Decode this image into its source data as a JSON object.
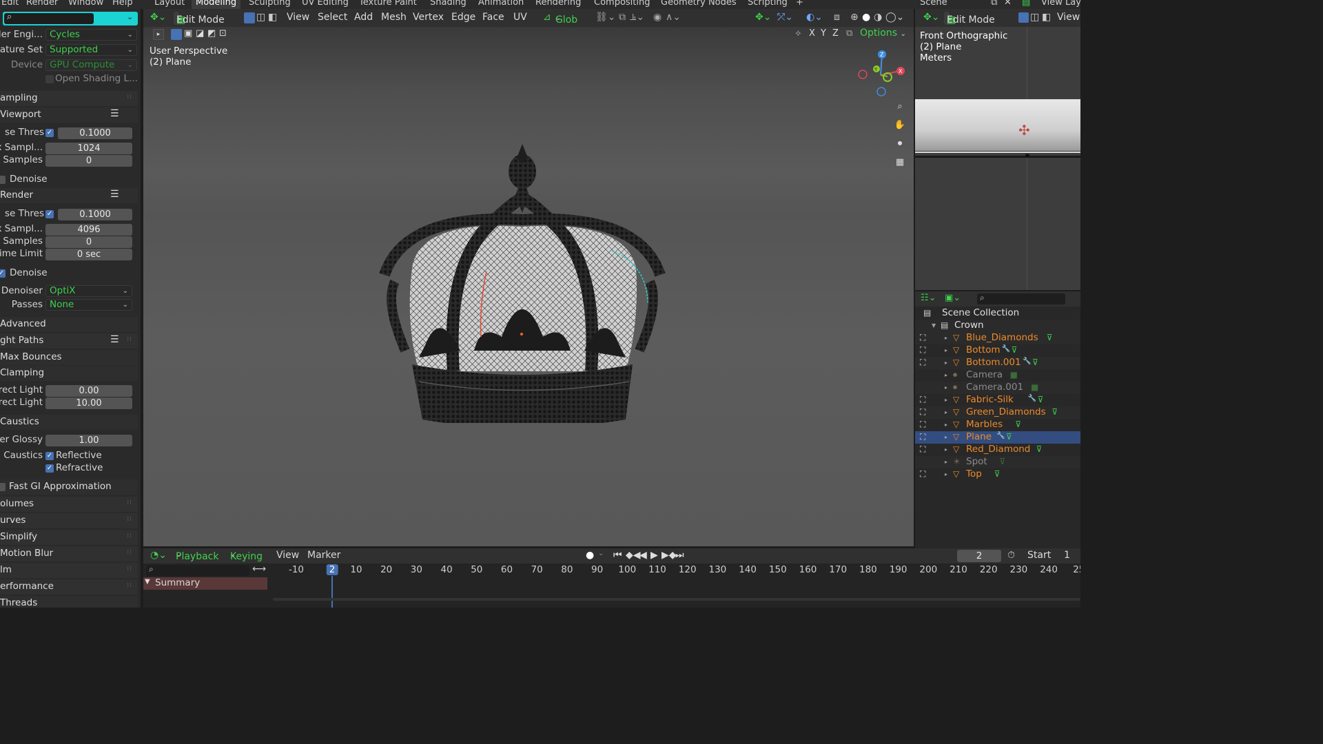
{
  "topbar": {
    "menus": [
      "Edit",
      "Render",
      "Window",
      "Help"
    ],
    "workspaces": [
      "Layout",
      "Modeling",
      "Sculpting",
      "UV Editing",
      "Texture Paint",
      "Shading",
      "Animation",
      "Rendering",
      "Compositing",
      "Geometry Nodes",
      "Scripting"
    ],
    "add_tab": "+",
    "scene_label": "Scene",
    "view_layer_label": "View Lay"
  },
  "viewport_header": {
    "mode": "Edit Mode",
    "menus": [
      "View",
      "Select",
      "Add",
      "Mesh",
      "Vertex",
      "Edge",
      "Face",
      "UV"
    ],
    "transform_orientation": "Glob",
    "options_label": "Options",
    "axes": [
      "X",
      "Y",
      "Z"
    ]
  },
  "viewport": {
    "view_name": "User Perspective",
    "object_name": "(2) Plane"
  },
  "right_viewport": {
    "mode": "Edit Mode",
    "view_menu": "View",
    "view_name": "Front Orthographic",
    "object_name": "(2) Plane",
    "units": "Meters"
  },
  "properties": {
    "render_engine": {
      "label": "der Engi...",
      "value": "Cycles"
    },
    "feature_set": {
      "label": "ature Set",
      "value": "Supported"
    },
    "device": {
      "label": "Device",
      "value": "GPU Compute"
    },
    "open_shading": {
      "label": "Open Shading L..."
    },
    "sampling_header": "ampling",
    "viewport_header": "Viewport",
    "viewport_noise_thresh": {
      "label": "se Thres",
      "value": "0.1000"
    },
    "viewport_max_samples": {
      "label": "x Sampl...",
      "value": "1024"
    },
    "viewport_min_samples": {
      "label": "Samples",
      "value": "0"
    },
    "viewport_denoise": {
      "label": "Denoise"
    },
    "render_header": "Render",
    "render_noise_thresh": {
      "label": "se Thres",
      "value": "0.1000"
    },
    "render_max_samples": {
      "label": "x Sampl...",
      "value": "4096"
    },
    "render_min_samples": {
      "label": "Samples",
      "value": "0"
    },
    "render_time_limit": {
      "label": "ime Limit",
      "value": "0 sec"
    },
    "render_denoise": {
      "label": "Denoise"
    },
    "denoiser": {
      "label": "Denoiser",
      "value": "OptiX"
    },
    "passes": {
      "label": "Passes",
      "value": "None"
    },
    "advanced_header": "Advanced",
    "light_paths_header": "ght Paths",
    "max_bounces_header": "Max Bounces",
    "clamping_header": "Clamping",
    "direct_light": {
      "label": "rect Light",
      "value": "0.00"
    },
    "indirect_light": {
      "label": "rect Light",
      "value": "10.00"
    },
    "caustics_header": "Caustics",
    "filter_glossy": {
      "label": "er Glossy",
      "value": "1.00"
    },
    "caustics": {
      "label": "Caustics",
      "reflective": "Reflective",
      "refractive": "Refractive"
    },
    "fast_gi": "Fast GI Approximation",
    "volumes_header": "olumes",
    "curves_header": "urves",
    "simplify_header": "Simplify",
    "motion_blur_header": "Motion Blur",
    "film_header": "lm",
    "performance_header": "erformance",
    "threads_header": "Threads"
  },
  "outliner": {
    "scene_collection": "Scene Collection",
    "collection": "Crown",
    "items": [
      {
        "name": "Blue_Diamonds",
        "kind": "mesh",
        "modifier": false
      },
      {
        "name": "Bottom",
        "kind": "mesh",
        "modifier": true
      },
      {
        "name": "Bottom.001",
        "kind": "mesh",
        "modifier": true
      },
      {
        "name": "Camera",
        "kind": "camera",
        "modifier": false
      },
      {
        "name": "Camera.001",
        "kind": "camera",
        "modifier": false
      },
      {
        "name": "Fabric-Silk",
        "kind": "mesh",
        "modifier": true
      },
      {
        "name": "Green_Diamonds",
        "kind": "mesh",
        "modifier": false
      },
      {
        "name": "Marbles",
        "kind": "mesh",
        "modifier": false
      },
      {
        "name": "Plane",
        "kind": "mesh",
        "modifier": true,
        "selected": true
      },
      {
        "name": "Red_Diamond",
        "kind": "mesh",
        "modifier": false
      },
      {
        "name": "Spot",
        "kind": "light",
        "modifier": false
      },
      {
        "name": "Top",
        "kind": "mesh",
        "modifier": false
      }
    ]
  },
  "timeline": {
    "menus": [
      "Playback",
      "Keying",
      "View",
      "Marker"
    ],
    "current_frame": "2",
    "start_label": "Start",
    "start_value": "1",
    "summary": "Summary",
    "ticks": [
      "-10",
      "10",
      "20",
      "30",
      "40",
      "50",
      "60",
      "70",
      "80",
      "90",
      "100",
      "110",
      "120",
      "130",
      "140",
      "150",
      "160",
      "170",
      "180",
      "190",
      "200",
      "210",
      "220",
      "230",
      "240",
      "25"
    ]
  },
  "colors": {
    "accent_green": "#3fd14d",
    "selection_blue": "#4772b3",
    "object_orange": "#ee8a2a",
    "frame_blue": "#4772b3"
  }
}
